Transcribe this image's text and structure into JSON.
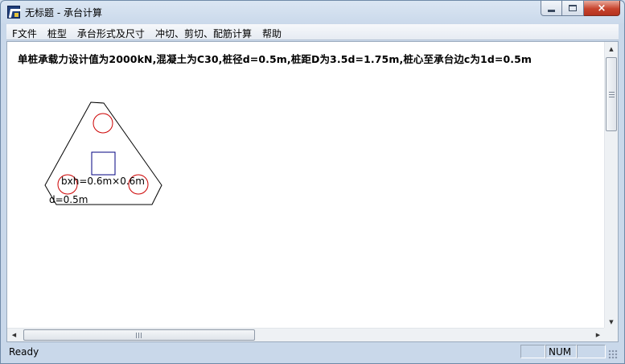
{
  "window": {
    "title": "无标题 - 承台计算",
    "controls": {
      "minimize": "minimize",
      "maximize": "maximize",
      "close": "×"
    }
  },
  "menu": {
    "items": [
      {
        "id": "file",
        "label": "F文件"
      },
      {
        "id": "pile-type",
        "label": "桩型"
      },
      {
        "id": "cap-shape",
        "label": "承台形式及尺寸"
      },
      {
        "id": "calc",
        "label": "冲切、剪切、配筋计算"
      },
      {
        "id": "help",
        "label": "帮助"
      }
    ]
  },
  "content": {
    "headline": "单桩承载力设计值为2000kN,混凝土为C30,桩径d=0.5m,桩距D为3.5d=1.75m,桩心至承台边c为1d=0.5m",
    "column_label": "bxh=0.6m×0.6m",
    "pile_label": "d=0.5m",
    "colors": {
      "outline": "#000000",
      "piles": "#cc0000",
      "column": "#000080"
    }
  },
  "status": {
    "text": "Ready",
    "panes": [
      "",
      "NUM",
      ""
    ]
  }
}
